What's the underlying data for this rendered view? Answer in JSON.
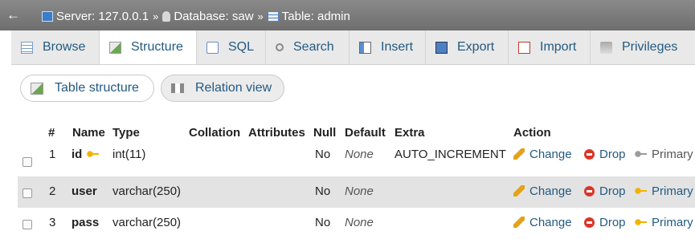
{
  "breadcrumb": {
    "back_label": "←",
    "server_label": "Server: 127.0.0.1",
    "database_label": "Database: saw",
    "table_label": "Table: admin",
    "separator": "»"
  },
  "tabs": [
    {
      "label": "Browse",
      "active": false
    },
    {
      "label": "Structure",
      "active": true
    },
    {
      "label": "SQL",
      "active": false
    },
    {
      "label": "Search",
      "active": false
    },
    {
      "label": "Insert",
      "active": false
    },
    {
      "label": "Export",
      "active": false
    },
    {
      "label": "Import",
      "active": false
    },
    {
      "label": "Privileges",
      "active": false
    }
  ],
  "subtabs": {
    "table_structure": "Table structure",
    "relation_view": "Relation view"
  },
  "columns": {
    "num": "#",
    "name": "Name",
    "type": "Type",
    "collation": "Collation",
    "attributes": "Attributes",
    "null": "Null",
    "default": "Default",
    "extra": "Extra",
    "action": "Action"
  },
  "rows": [
    {
      "num": "1",
      "name": "id",
      "type": "int(11)",
      "null": "No",
      "default": "None",
      "extra": "AUTO_INCREMENT",
      "change": "Change",
      "drop": "Drop",
      "primary": "Primary"
    },
    {
      "num": "2",
      "name": "user",
      "type": "varchar(250)",
      "null": "No",
      "default": "None",
      "extra": "",
      "change": "Change",
      "drop": "Drop",
      "primary": "Primary"
    },
    {
      "num": "3",
      "name": "pass",
      "type": "varchar(250)",
      "null": "No",
      "default": "None",
      "extra": "",
      "change": "Change",
      "drop": "Drop",
      "primary": "Primary"
    }
  ]
}
